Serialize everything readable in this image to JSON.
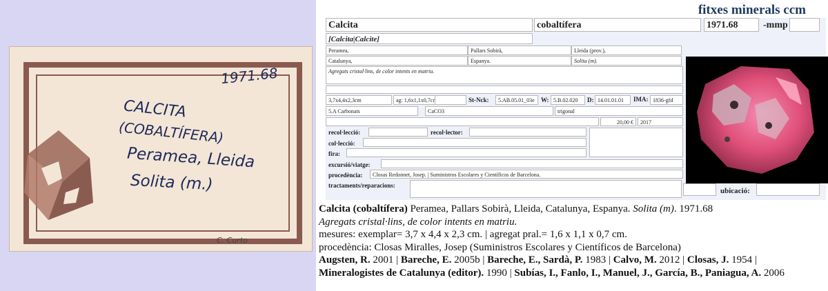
{
  "label": {
    "number": "1971.68",
    "line1": "CALCITA",
    "line2": "(COBALTÍFERA)",
    "line3": "Peramea, Lleida",
    "line4": "Solita (m.)",
    "collector": "C. Curto"
  },
  "header": {
    "brand": "fitxes minerals ccm"
  },
  "form": {
    "mineral": "Calcita",
    "variety": "cobaltífera",
    "code": "1971.68",
    "suffix": "-mmp",
    "synonyms": "[Calcita|Calcite]",
    "locality": "Peramea,",
    "region": "Pallars Sobirà,",
    "province": "Lleida (prov.),",
    "community": "Catalunya,",
    "country": "Espanya.",
    "mine": "Solita (m).",
    "description": "Agregats cristal·lins, de color intents en matriu.",
    "size": "3,7x4,4x2,3cm",
    "aggregate": "ag: 1,6x1,1x0,7cm",
    "stnck_label": "St-Nck:",
    "stnck": "5.AB.05.01_03e",
    "w_label": "W:",
    "w": "5.B.02.020",
    "d_label": "D:",
    "d": "14.01.01.01",
    "ima_label": "IMA:",
    "ima": "1836-gfd",
    "class": "5.A Carbonats",
    "formula": "CaCO3",
    "system": "trigonal",
    "price": "20,00 €",
    "year": "2017",
    "collection_label": "recol·lecció:",
    "collector_label": "recol·lector:",
    "coleccio_label": "col·lecció:",
    "fira_label": "fira:",
    "excursio_label": "excursió/viatge:",
    "procedencia_label": "procedència:",
    "procedencia": "Closas Redonnet, Josep. | Suministros Escolares y Científicos de Barcelona.",
    "tractaments_label": "tractaments/reparacions:",
    "ubicacio_label": "ubicació:"
  },
  "summary": {
    "title_bold": "Calcita (cobaltífera)",
    "title_rest": " Peramea, Pallars Sobirà, Lleida, Catalunya, Espanya. ",
    "mine_it": "Solita (m)",
    "number": ". 1971.68",
    "desc": "Agregats cristal·lins, de color intents en matriu.",
    "mesures": "mesures: exemplar= 3,7 x 4,4 x 2,3 cm. | agregat pral.= 1,6 x 1,1 x 0,7 cm.",
    "procedencia": "procedència: Closas Miralles, Josep (Suministros Escolares y Científicos de Barcelona)",
    "refs": [
      {
        "a": "Augsten, R.",
        "y": " 2001 | "
      },
      {
        "a": "Bareche, E.",
        "y": " 2005b | "
      },
      {
        "a": "Bareche, E., Sardà, P.",
        "y": " 1983 | "
      },
      {
        "a": "Calvo, M.",
        "y": " 2012 | "
      },
      {
        "a": "Closas, J.",
        "y": " 1954 | "
      },
      {
        "a": "Mineralogistes de Catalunya (editor).",
        "y": " 1990 | "
      },
      {
        "a": "Subías, I., Fanlo, I., Manuel, J., García, B., Paniagua, A.",
        "y": " 2006"
      }
    ]
  },
  "colors": {
    "frame": "#8a5a4e",
    "ink": "#1f2a5a",
    "brand": "#1e3a5f",
    "mineral_pink": "#e0507a"
  }
}
